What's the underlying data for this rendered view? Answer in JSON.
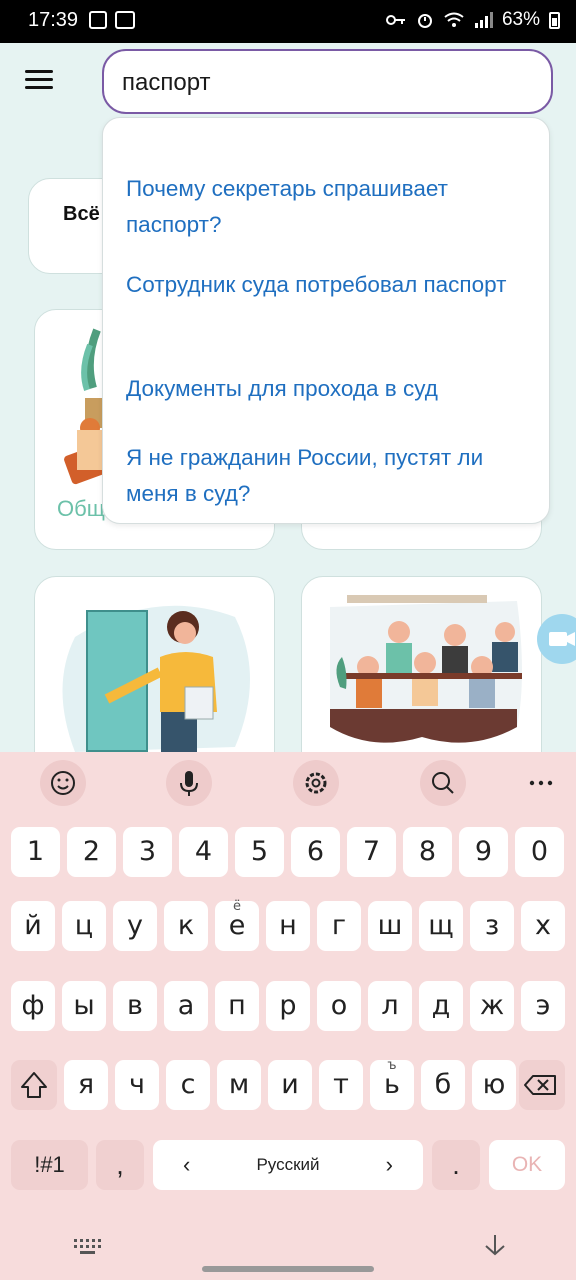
{
  "status_bar": {
    "time": "17:39",
    "battery": "63%",
    "left_icons": [
      "gallery-icon",
      "video-recorder-icon"
    ],
    "right_icons": [
      "key-icon",
      "alarm-icon",
      "wifi-icon",
      "signal-icon",
      "battery-icon"
    ]
  },
  "app_bar": {
    "menu_icon": "hamburger-menu-icon",
    "search_value": "паспорт"
  },
  "background": {
    "all_card_label": "Всё",
    "category_card_label": "Общ"
  },
  "suggestions": [
    "Почему секретарь спрашивает паспорт?",
    "Сотрудник суда потребовал паспорт",
    "Документы для прохода в суд",
    "Я не гражданин России, пустят ли меня в суд?"
  ],
  "keyboard": {
    "toolbar": [
      "emoji-icon",
      "microphone-icon",
      "settings-icon",
      "search-icon",
      "more-icon"
    ],
    "row_numbers": [
      "1",
      "2",
      "3",
      "4",
      "5",
      "6",
      "7",
      "8",
      "9",
      "0"
    ],
    "row1": [
      "й",
      "ц",
      "у",
      "к",
      "е",
      "н",
      "г",
      "ш",
      "щ",
      "з",
      "х"
    ],
    "row1_hint_e": "ё",
    "row2": [
      "ф",
      "ы",
      "в",
      "а",
      "п",
      "р",
      "о",
      "л",
      "д",
      "ж",
      "э"
    ],
    "row3": [
      "я",
      "ч",
      "с",
      "м",
      "и",
      "т",
      "ь",
      "б",
      "ю"
    ],
    "row3_hint_soft": "ъ",
    "symbols_label": "!#1",
    "comma_label": ",",
    "space_label": "Русский",
    "space_left": "‹",
    "space_right": "›",
    "period_label": ".",
    "ok_label": "OK"
  },
  "colors": {
    "accent_border": "#7a5aa5",
    "link": "#1f6fc0",
    "category": "#6cc1a9",
    "keyboard_bg": "#f7dcdc"
  }
}
